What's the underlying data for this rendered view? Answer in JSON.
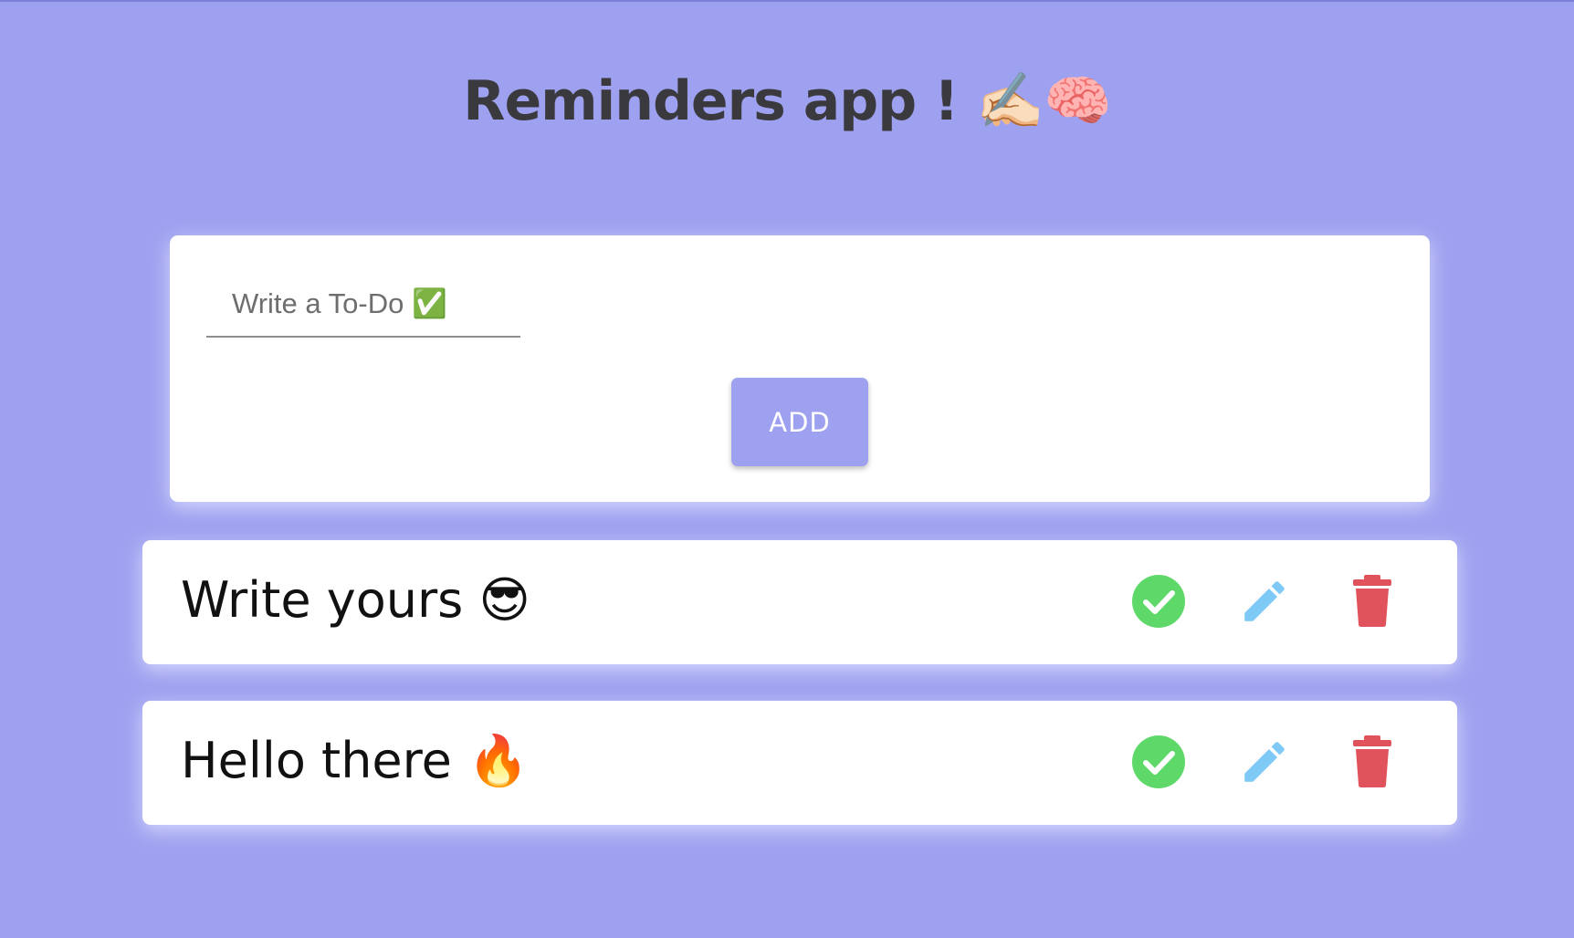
{
  "app": {
    "title": "Reminders app ! ✍🏻🧠"
  },
  "form": {
    "input_placeholder": "Write a To-Do ✅",
    "input_value": "",
    "add_label": "ADD"
  },
  "todos": [
    {
      "text": "Write yours 😎"
    },
    {
      "text": "Hello there 🔥"
    }
  ],
  "icons": {
    "complete": "check-circle-icon",
    "edit": "pencil-icon",
    "delete": "trash-icon"
  },
  "colors": {
    "background": "#9ea1ef",
    "accent": "#9ea1ef",
    "complete": "#5fd86a",
    "edit": "#7ec9f5",
    "delete": "#e0525c"
  }
}
